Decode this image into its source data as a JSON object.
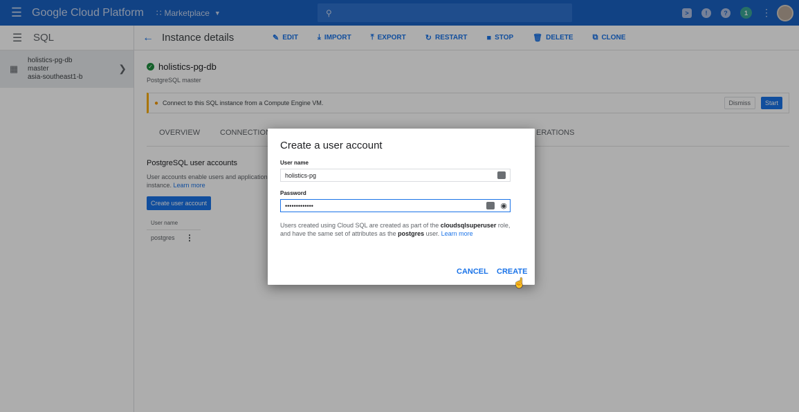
{
  "topbar": {
    "brand": "Google Cloud Platform",
    "project": "Marketplace",
    "search_placeholder": ""
  },
  "sidebar": {
    "title": "SQL",
    "instance": {
      "name": "holistics-pg-db",
      "role": "master",
      "region": "asia-southeast1-b"
    }
  },
  "header": {
    "title": "Instance details",
    "actions": [
      "EDIT",
      "IMPORT",
      "EXPORT",
      "RESTART",
      "STOP",
      "DELETE",
      "CLONE"
    ]
  },
  "instance": {
    "name": "holistics-pg-db",
    "subtitle": "PostgreSQL master"
  },
  "banner": {
    "text": "Connect to this SQL instance from a Compute Engine VM.",
    "dismiss": "Dismiss",
    "start": "Start"
  },
  "tabs": [
    "OVERVIEW",
    "CONNECTIONS",
    "ERATIONS"
  ],
  "users_section": {
    "title": "PostgreSQL user accounts",
    "desc_a": "User accounts enable users and application",
    "desc_b": "instance.",
    "learn_more": "Learn more",
    "create_button": "Create user account",
    "col_header": "User name",
    "rows": [
      "postgres"
    ]
  },
  "dialog": {
    "title": "Create a user account",
    "username_label": "User name",
    "username_value": "holistics-pg",
    "password_label": "Password",
    "password_value": "•••••••••••••",
    "hint_1": "Users created using Cloud SQL are created as part of the ",
    "hint_bold_1": "cloudsqlsuperuser",
    "hint_2": " role,",
    "hint_3": "and have the same set of attributes as the ",
    "hint_bold_2": "postgres",
    "hint_4": " user. ",
    "hint_link": "Learn more",
    "cancel": "CANCEL",
    "create": "CREATE"
  },
  "colors": {
    "topbar": "#1a62c3",
    "accent": "#1a73e8",
    "banner_accent": "#f9ab00",
    "ok": "#1e8e3e"
  }
}
